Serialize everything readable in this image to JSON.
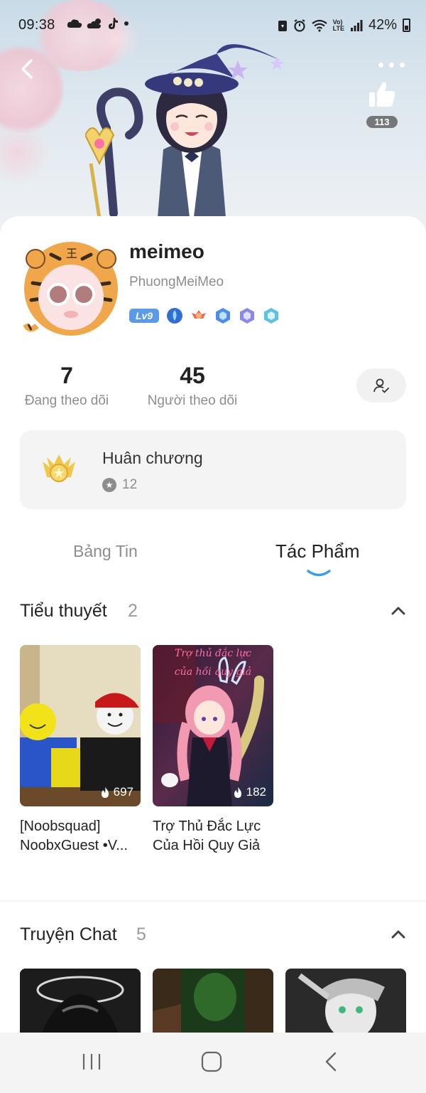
{
  "status_bar": {
    "time": "09:38",
    "left_icons": [
      "cloud-icon",
      "cloud-sun-icon",
      "tiktok-icon",
      "dot-icon"
    ],
    "right_icons": [
      "battery-saver-icon",
      "alarm-icon",
      "wifi-icon",
      "volte-icon",
      "signal-icon"
    ],
    "network_label_top": "Vo)",
    "network_label_bottom": "LTE",
    "battery": "42%"
  },
  "header": {
    "like_count": "113"
  },
  "profile": {
    "username": "meimeo",
    "handle": "PhuongMeiMeo",
    "level": "Lv9",
    "badge_icons": [
      "blue-drop-badge-icon",
      "red-wing-badge-icon",
      "hex-blue-badge-icon",
      "hex-purple-badge-icon",
      "hex-teal-badge-icon"
    ],
    "following_count": "7",
    "following_label": "Đang theo dõi",
    "followers_count": "45",
    "followers_label": "Người theo dõi"
  },
  "medals": {
    "title": "Huân chương",
    "count": "12"
  },
  "tabs": [
    {
      "label": "Bảng Tin",
      "active": false
    },
    {
      "label": "Tác Phẩm",
      "active": true
    }
  ],
  "sections": [
    {
      "title": "Tiểu thuyết",
      "count": "2",
      "items": [
        {
          "title_line1": "[Noobsquad]",
          "title_line2": "NoobxGuest •V...",
          "views": "697"
        },
        {
          "title_line1": "Trợ Thủ Đắc Lực",
          "title_line2": "Của Hồi Quy Giả",
          "views": "182",
          "cover_text_1": "Trợ thủ đắc lực",
          "cover_text_2": "của hồi quy giả"
        }
      ]
    },
    {
      "title": "Truyện Chat",
      "count": "5"
    }
  ],
  "nav": {
    "buttons": [
      "recent-apps-icon",
      "home-icon",
      "back-icon"
    ]
  },
  "colors": {
    "level_badge": "#5a9ae8",
    "tab_indicator": "#3d9be9",
    "fire_icon": "#ffffff"
  }
}
